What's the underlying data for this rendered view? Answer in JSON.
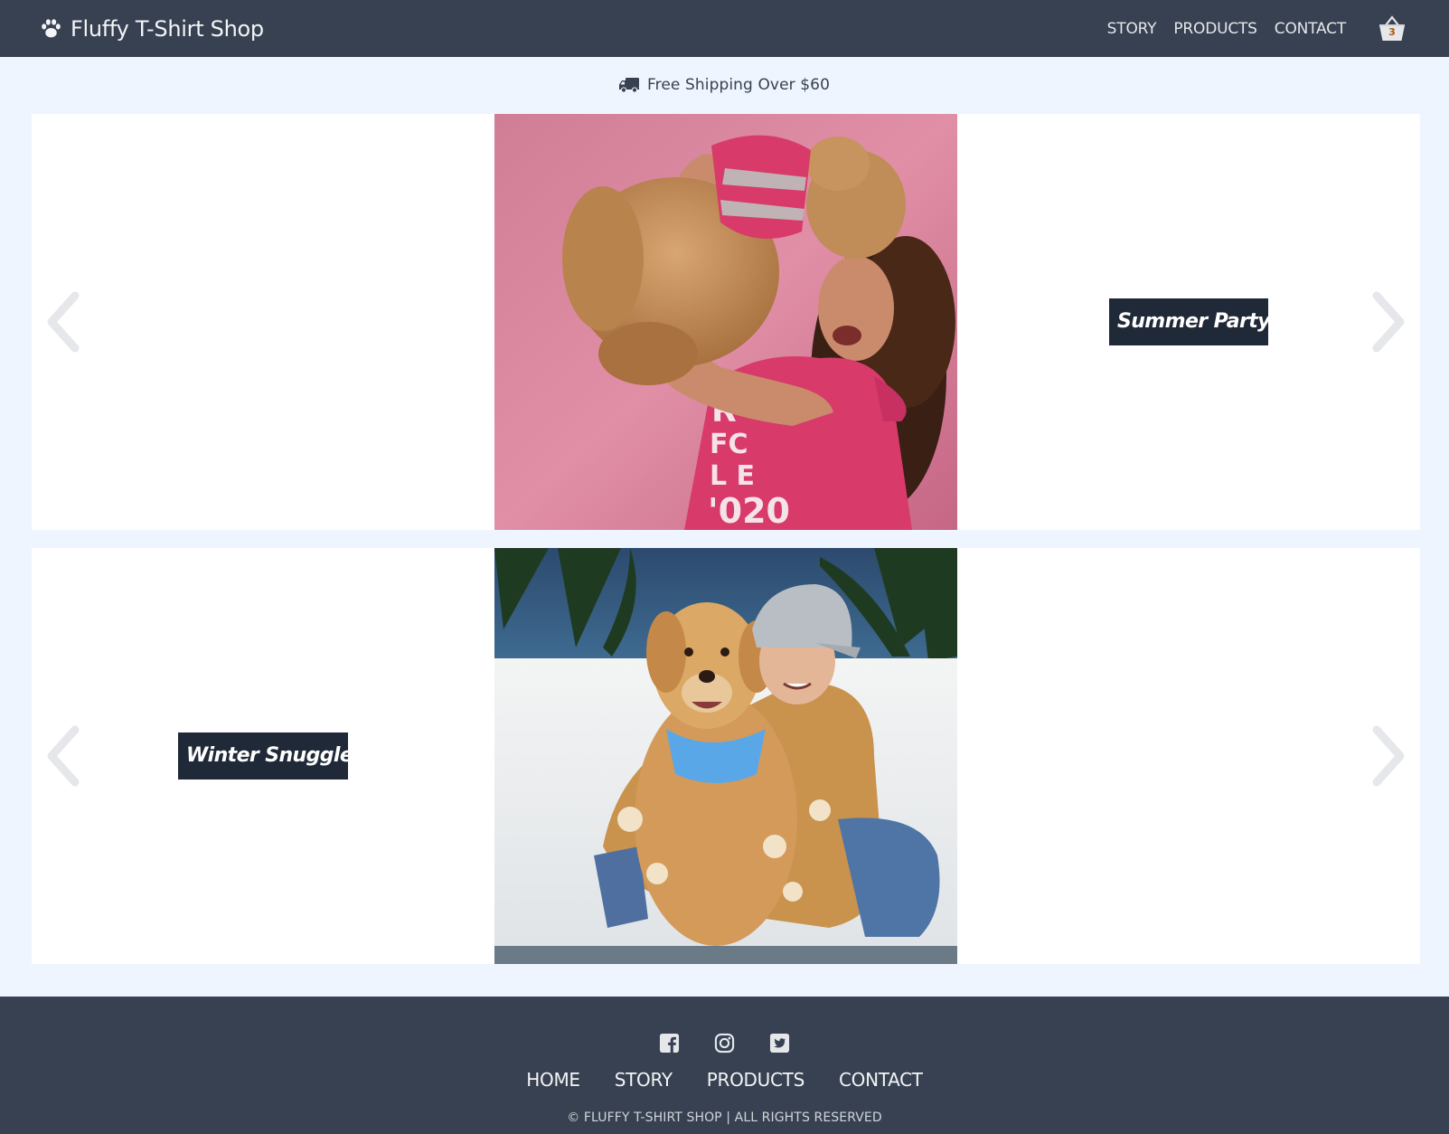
{
  "header": {
    "brand_icon": "paw-icon",
    "brand_title": "Fluffy T-Shirt Shop",
    "nav": [
      {
        "label": "STORY"
      },
      {
        "label": "PRODUCTS"
      },
      {
        "label": "CONTACT"
      }
    ],
    "cart_icon": "basket-icon",
    "cart_count": "3"
  },
  "banner": {
    "icon": "truck-icon",
    "text": "Free Shipping Over $60"
  },
  "slides": [
    {
      "caption": "Summer Party",
      "image": "woman-lifting-dog-pink-shirts",
      "prev_icon": "chevron-left-icon",
      "next_icon": "chevron-right-icon"
    },
    {
      "caption": "Winter Snuggle",
      "image": "person-hugging-golden-retriever",
      "prev_icon": "chevron-left-icon",
      "next_icon": "chevron-right-icon"
    }
  ],
  "footer": {
    "socials": [
      {
        "icon": "facebook-icon"
      },
      {
        "icon": "instagram-icon"
      },
      {
        "icon": "twitter-icon"
      }
    ],
    "nav": [
      {
        "label": "HOME"
      },
      {
        "label": "STORY"
      },
      {
        "label": "PRODUCTS"
      },
      {
        "label": "CONTACT"
      }
    ],
    "copyright": "© FLUFFY T-SHIRT SHOP | ALL RIGHTS RESERVED"
  },
  "colors": {
    "header_bg": "#374151",
    "page_bg": "#eff5fe",
    "caption_bg": "#1f2937",
    "arrow": "#e5e7eb"
  }
}
